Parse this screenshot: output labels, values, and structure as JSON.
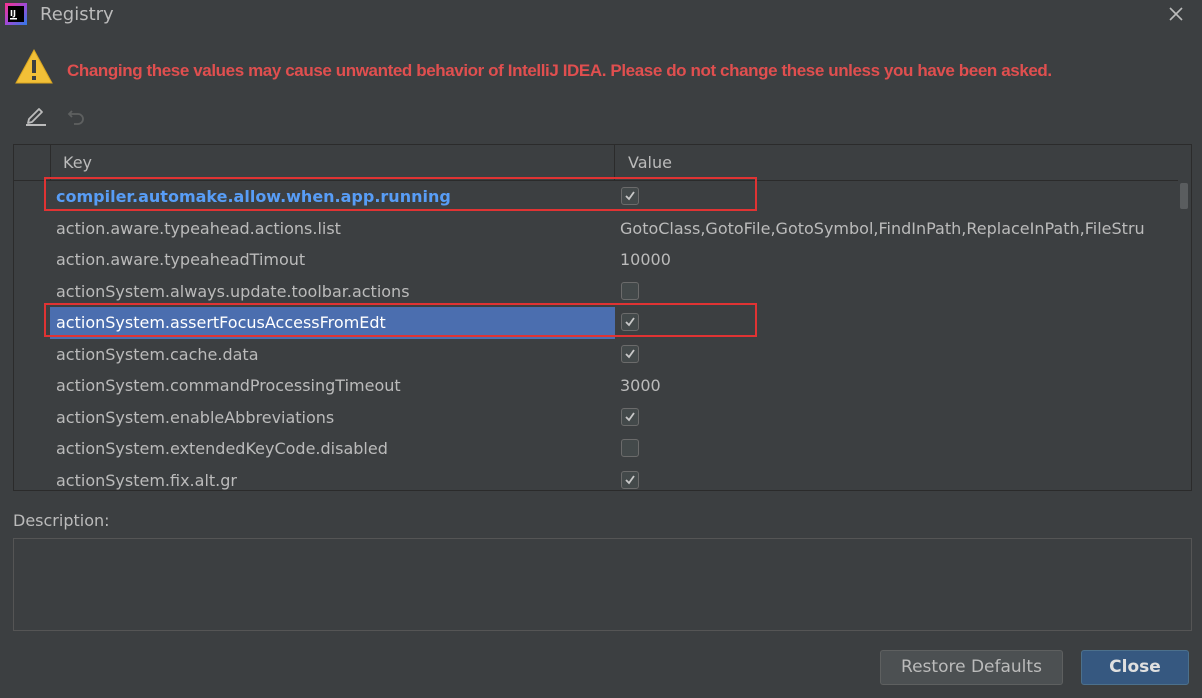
{
  "window": {
    "title": "Registry"
  },
  "warning": {
    "text": "Changing these values may cause unwanted behavior of IntelliJ IDEA. Please do not change these unless you have been asked."
  },
  "table": {
    "columns": [
      "Key",
      "Value"
    ],
    "rows": [
      {
        "key": "compiler.automake.allow.when.app.running",
        "type": "checkbox",
        "checked": true,
        "modified": true,
        "selected": false,
        "highlighted": true
      },
      {
        "key": "action.aware.typeahead.actions.list",
        "type": "text",
        "value": "GotoClass,GotoFile,GotoSymbol,FindInPath,ReplaceInPath,FileStru",
        "modified": false,
        "selected": false,
        "highlighted": false
      },
      {
        "key": "action.aware.typeaheadTimout",
        "type": "text",
        "value": "10000",
        "modified": false,
        "selected": false,
        "highlighted": false
      },
      {
        "key": "actionSystem.always.update.toolbar.actions",
        "type": "checkbox",
        "checked": false,
        "modified": false,
        "selected": false,
        "highlighted": false
      },
      {
        "key": "actionSystem.assertFocusAccessFromEdt",
        "type": "checkbox",
        "checked": true,
        "modified": false,
        "selected": true,
        "highlighted": true
      },
      {
        "key": "actionSystem.cache.data",
        "type": "checkbox",
        "checked": true,
        "modified": false,
        "selected": false,
        "highlighted": false
      },
      {
        "key": "actionSystem.commandProcessingTimeout",
        "type": "text",
        "value": "3000",
        "modified": false,
        "selected": false,
        "highlighted": false
      },
      {
        "key": "actionSystem.enableAbbreviations",
        "type": "checkbox",
        "checked": true,
        "modified": false,
        "selected": false,
        "highlighted": false
      },
      {
        "key": "actionSystem.extendedKeyCode.disabled",
        "type": "checkbox",
        "checked": false,
        "modified": false,
        "selected": false,
        "highlighted": false
      },
      {
        "key": "actionSystem.fix.alt.gr",
        "type": "checkbox",
        "checked": true,
        "modified": false,
        "selected": false,
        "highlighted": false
      }
    ]
  },
  "description": {
    "label": "Description:",
    "text": ""
  },
  "buttons": {
    "restore_defaults": "Restore Defaults",
    "close": "Close"
  },
  "colors": {
    "background": "#3c3f41",
    "warning_text": "#e04f4f",
    "modified_key": "#589df6",
    "selection": "#4b6eaf",
    "highlight_box": "#e03333",
    "primary_button": "#365880"
  },
  "icons": [
    "intellij-logo-icon",
    "close-icon",
    "warning-icon",
    "edit-icon",
    "revert-icon",
    "checkmark-icon"
  ]
}
